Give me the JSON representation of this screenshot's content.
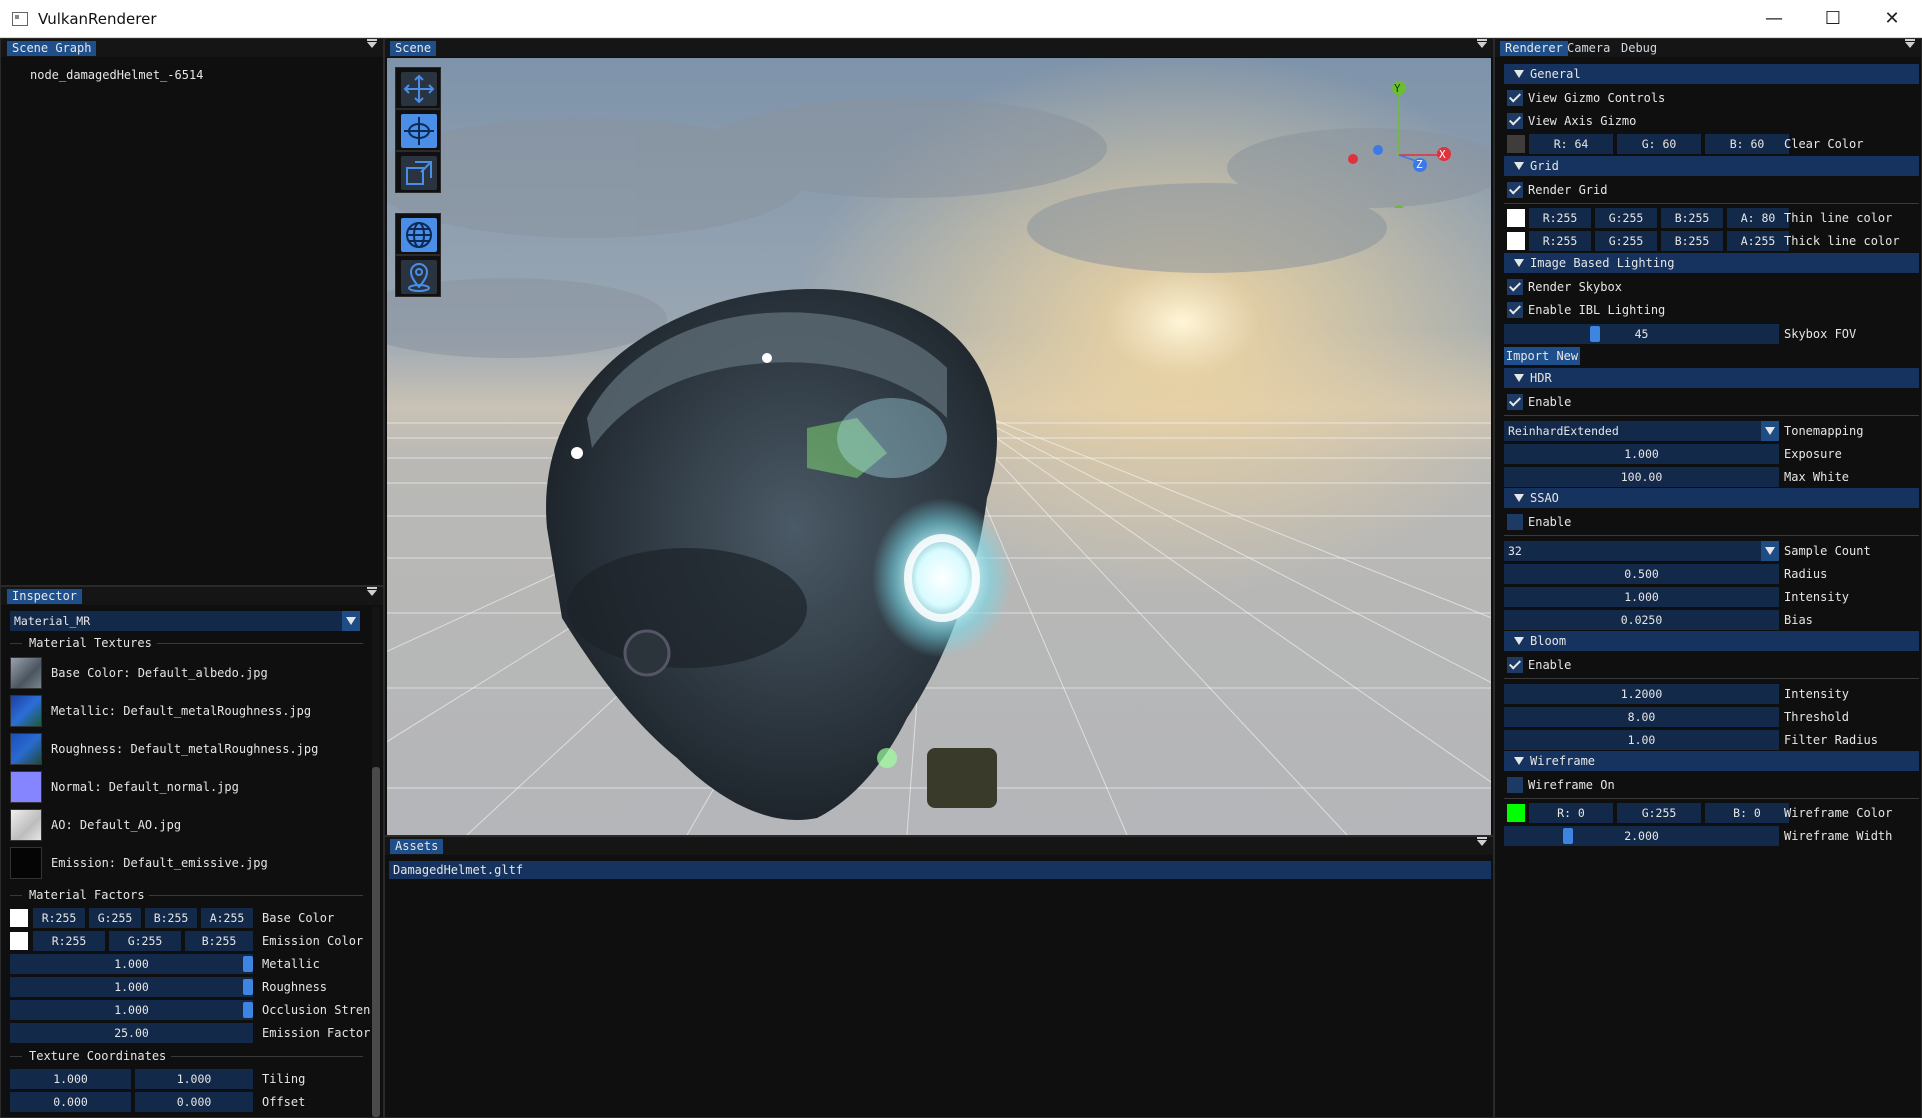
{
  "window": {
    "title": "VulkanRenderer",
    "min_glyph": "—",
    "max_glyph": "☐",
    "close_glyph": "✕"
  },
  "scene_graph": {
    "tab": "Scene Graph",
    "nodes": [
      "node_damagedHelmet_-6514"
    ]
  },
  "scene": {
    "tab": "Scene",
    "axes": {
      "x": "X",
      "y": "Y",
      "z": "Z"
    },
    "toolbar": [
      "move-icon",
      "rotate-icon",
      "scale-icon",
      "globe-icon",
      "pin-icon"
    ]
  },
  "inspector": {
    "tab": "Inspector",
    "material": "Material_MR",
    "textures_header": "Material Textures",
    "textures": [
      {
        "label": "Base Color: Default_albedo.jpg",
        "icon": "albedo-thumb",
        "color": "#6f7780"
      },
      {
        "label": "Metallic: Default_metalRoughness.jpg",
        "icon": "metal-thumb",
        "color": "#1f55c2"
      },
      {
        "label": "Roughness: Default_metalRoughness.jpg",
        "icon": "rough-thumb",
        "color": "#1f55c2"
      },
      {
        "label": "Normal: Default_normal.jpg",
        "icon": "normal-thumb",
        "color": "#8585ff"
      },
      {
        "label": "AO: Default_AO.jpg",
        "icon": "ao-thumb",
        "color": "#d8d8d8"
      },
      {
        "label": "Emission: Default_emissive.jpg",
        "icon": "emissive-thumb",
        "color": "#050505"
      }
    ],
    "factors_header": "Material Factors",
    "base_color": {
      "r": "R:255",
      "g": "G:255",
      "b": "B:255",
      "a": "A:255",
      "label": "Base Color"
    },
    "emission_color": {
      "r": "R:255",
      "g": "G:255",
      "b": "B:255",
      "label": "Emission Color"
    },
    "metallic": {
      "value": "1.000",
      "label": "Metallic"
    },
    "roughness": {
      "value": "1.000",
      "label": "Roughness"
    },
    "occlusion": {
      "value": "1.000",
      "label": "Occlusion Stren"
    },
    "emission_factor": {
      "value": "25.00",
      "label": "Emission Factor"
    },
    "texcoord_header": "Texture Coordinates",
    "tiling": {
      "u": "1.000",
      "v": "1.000",
      "label": "Tiling"
    },
    "offset": {
      "u": "0.000",
      "v": "0.000",
      "label": "Offset"
    }
  },
  "assets": {
    "tab": "Assets",
    "files": [
      "DamagedHelmet.gltf"
    ]
  },
  "renderer": {
    "tabs": [
      "Renderer",
      "Camera",
      "Debug"
    ],
    "general": {
      "title": "General",
      "view_gizmo": "View Gizmo Controls",
      "view_axis": "View Axis Gizmo",
      "clear_r": "R: 64",
      "clear_g": "G: 60",
      "clear_b": "B: 60",
      "clear_label": "Clear Color",
      "clear_swatch": "#403c3c"
    },
    "grid": {
      "title": "Grid",
      "render_grid": "Render Grid",
      "thin": {
        "r": "R:255",
        "g": "G:255",
        "b": "B:255",
        "a": "A: 80",
        "label": "Thin line color"
      },
      "thick": {
        "r": "R:255",
        "g": "G:255",
        "b": "B:255",
        "a": "A:255",
        "label": "Thick line color"
      }
    },
    "ibl": {
      "title": "Image Based Lighting",
      "render_skybox": "Render Skybox",
      "enable_ibl": "Enable IBL Lighting",
      "fov": "45",
      "fov_label": "Skybox FOV",
      "import": "Import New"
    },
    "hdr": {
      "title": "HDR",
      "enable": "Enable",
      "tonemap": "ReinhardExtended",
      "tonemap_label": "Tonemapping",
      "exposure": "1.000",
      "exposure_label": "Exposure",
      "max_white": "100.00",
      "max_white_label": "Max White"
    },
    "ssao": {
      "title": "SSAO",
      "enable": "Enable",
      "samples": "32",
      "samples_label": "Sample Count",
      "radius": "0.500",
      "radius_label": "Radius",
      "intensity": "1.000",
      "intensity_label": "Intensity",
      "bias": "0.0250",
      "bias_label": "Bias"
    },
    "bloom": {
      "title": "Bloom",
      "enable": "Enable",
      "intensity": "1.2000",
      "intensity_label": "Intensity",
      "threshold": "8.00",
      "threshold_label": "Threshold",
      "filter": "1.00",
      "filter_label": "Filter Radius"
    },
    "wireframe": {
      "title": "Wireframe",
      "on": "Wireframe On",
      "r": "R: 0",
      "g": "G:255",
      "b": "B: 0",
      "color_label": "Wireframe Color",
      "color_swatch": "#00ff00",
      "width": "2.000",
      "width_label": "Wireframe Width"
    }
  }
}
